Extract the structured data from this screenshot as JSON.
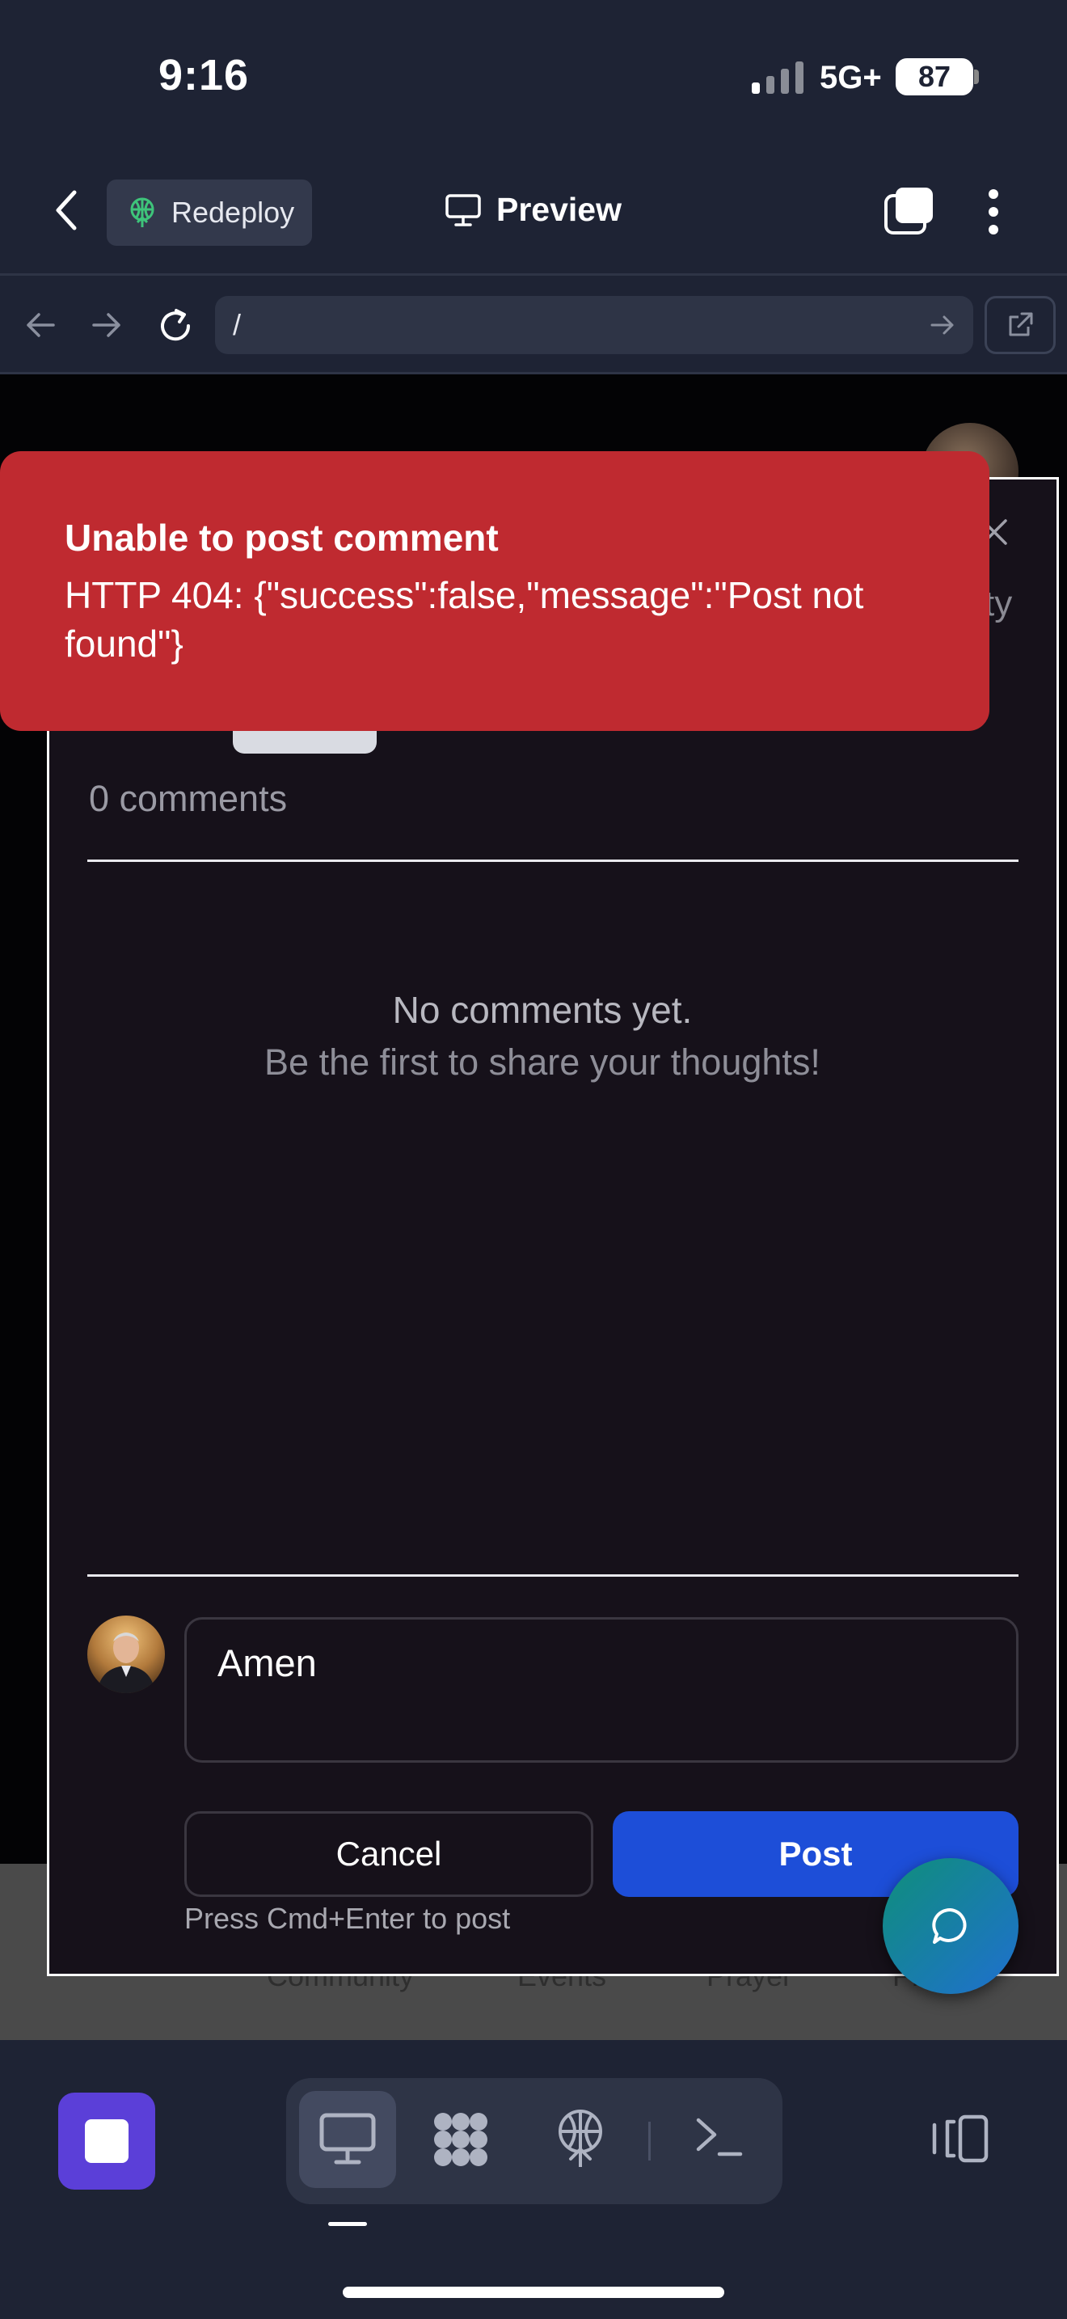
{
  "status_bar": {
    "time": "9:16",
    "network": "5G+",
    "battery": "87"
  },
  "header": {
    "redeploy_label": "Redeploy",
    "preview_label": "Preview"
  },
  "browser": {
    "url": "/"
  },
  "background_page": {
    "nav_items": [
      "Community",
      "Events",
      "Prayer",
      "Pr"
    ],
    "partial_text": "ty"
  },
  "modal": {
    "comments_count": "0 comments",
    "empty_title": "No comments yet.",
    "empty_subtitle": "Be the first to share your thoughts!",
    "comment_value": "Amen",
    "cancel_label": "Cancel",
    "post_label": "Post",
    "hint": "Press Cmd+Enter to post"
  },
  "toast": {
    "title": "Unable to post comment",
    "message": "HTTP 404: {\"success\":false,\"message\":\"Post not found\"}"
  },
  "colors": {
    "toast_bg": "#bf2a30",
    "post_button": "#1d4ed8",
    "stop_button": "#5b3fd8",
    "app_chrome": "#1e2334"
  }
}
